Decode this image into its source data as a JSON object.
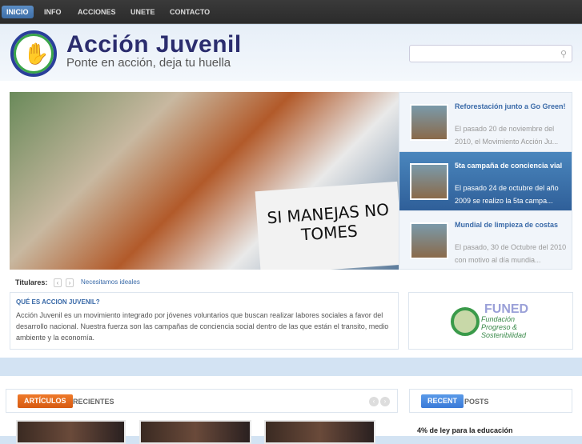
{
  "nav": {
    "items": [
      "INICIO",
      "INFO",
      "ACCIONES",
      "UNETE",
      "CONTACTO"
    ]
  },
  "header": {
    "title": "Acción Juvenil",
    "tagline": "Ponte en acción, deja tu huella",
    "logo_text": "Acción Juvenil",
    "search_placeholder": ""
  },
  "slider": {
    "sign_text": "SI MANEJAS NO TOMES"
  },
  "featured": [
    {
      "title": "Reforestación junto a Go Green!",
      "desc": "El pasado 20 de noviembre del 2010, el Movimiento Acción Ju..."
    },
    {
      "title": "5ta campaña de conciencia vial",
      "desc": "El pasado 24 de octubre del año 2009 se realizo la 5ta campa..."
    },
    {
      "title": "Mundial de limpieza de costas",
      "desc": "El pasado, 30 de Octubre del 2010 con motivo al día mundia..."
    }
  ],
  "ticker": {
    "label": "Titulares:",
    "prev": "‹",
    "next": "›",
    "headline": "Necesitamos ideales"
  },
  "about": {
    "title": "QUÉ ES ACCION JUVENIL?",
    "text": "Acción Juvenil es un movimiento integrado por jóvenes voluntarios que buscan realizar labores sociales a favor del desarrollo nacional. Nuestra fuerza son las campañas de conciencia social dentro de las que están el transito, medio ambiente y la economía."
  },
  "sponsor": {
    "name": "FUNED",
    "subtitle": "Fundación Progreso & Sostenibilidad"
  },
  "articles": {
    "tab": "ARTÍCULOS",
    "rest": "RECIENTES"
  },
  "recent_posts": {
    "tab": "RECENT",
    "rest": "POSTS",
    "items": [
      "4% de ley para la educación"
    ]
  }
}
